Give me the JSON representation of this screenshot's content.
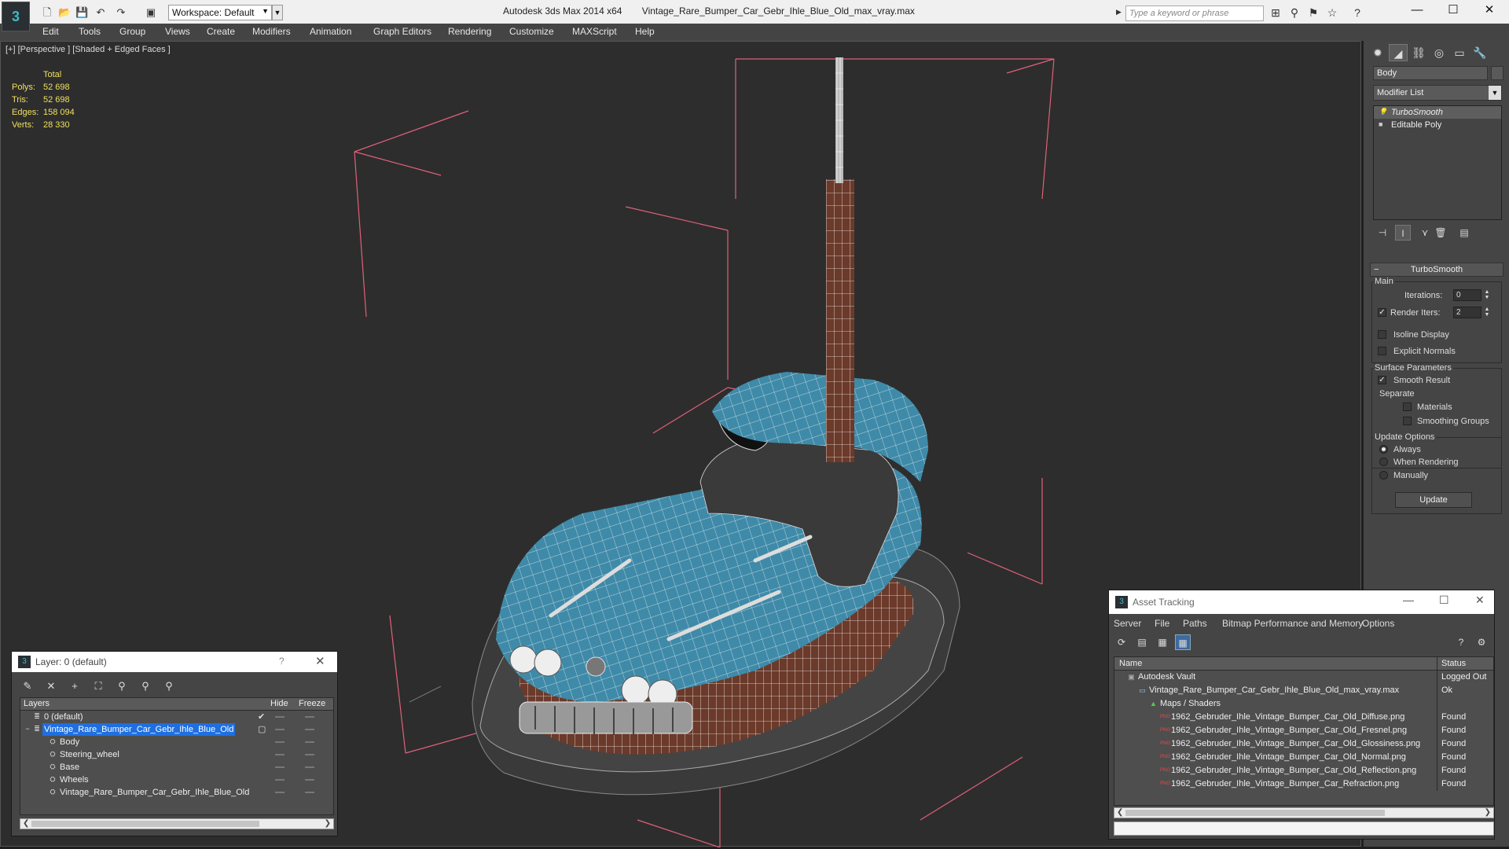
{
  "titlebar": {
    "workspace": "Workspace: Default",
    "app_version": "Autodesk 3ds Max  2014 x64",
    "file_name": "Vintage_Rare_Bumper_Car_Gebr_Ihle_Blue_Old_max_vray.max",
    "search_placeholder": "Type a keyword or phrase"
  },
  "menu": [
    "Edit",
    "Tools",
    "Group",
    "Views",
    "Create",
    "Modifiers",
    "Animation",
    "Graph Editors",
    "Rendering",
    "Customize",
    "MAXScript",
    "Help"
  ],
  "viewport": {
    "label": "[+] [Perspective ] [Shaded + Edged Faces ]",
    "stats_header": "Total",
    "stats": [
      {
        "label": "Polys:",
        "value": "52 698"
      },
      {
        "label": "Tris:",
        "value": "52 698"
      },
      {
        "label": "Edges:",
        "value": "158 094"
      },
      {
        "label": "Verts:",
        "value": "28 330"
      }
    ]
  },
  "command_panel": {
    "object_name": "Body",
    "modifier_list": "Modifier List",
    "stack": [
      "TurboSmooth",
      "Editable Poly"
    ],
    "rollout_title": "TurboSmooth",
    "main_label": "Main",
    "iterations_label": "Iterations:",
    "iterations_value": "0",
    "render_iters_label": "Render Iters:",
    "render_iters_value": "2",
    "isoline_label": "Isoline Display",
    "explicit_normals_label": "Explicit Normals",
    "surface_params_label": "Surface Parameters",
    "smooth_result_label": "Smooth Result",
    "separate_label": "Separate",
    "materials_label": "Materials",
    "smoothing_groups_label": "Smoothing Groups",
    "update_options_label": "Update Options",
    "always_label": "Always",
    "when_rendering_label": "When Rendering",
    "manually_label": "Manually",
    "update_button": "Update"
  },
  "layer_explorer": {
    "title": "Layer: 0 (default)",
    "help": "?",
    "col_layers": "Layers",
    "col_hide": "Hide",
    "col_freeze": "Freeze",
    "rows": [
      {
        "name": "0 (default)",
        "indent": 0,
        "icon": "layer-icon"
      },
      {
        "name": "Vintage_Rare_Bumper_Car_Gebr_Ihle_Blue_Old",
        "indent": 0,
        "icon": "layer-icon",
        "selected": true
      },
      {
        "name": "Body",
        "indent": 1,
        "icon": "object-icon"
      },
      {
        "name": "Steering_wheel",
        "indent": 1,
        "icon": "object-icon"
      },
      {
        "name": "Base",
        "indent": 1,
        "icon": "object-icon"
      },
      {
        "name": "Wheels",
        "indent": 1,
        "icon": "object-icon"
      },
      {
        "name": "Vintage_Rare_Bumper_Car_Gebr_Ihle_Blue_Old",
        "indent": 1,
        "icon": "object-icon"
      }
    ]
  },
  "asset_tracking": {
    "title": "Asset Tracking",
    "menu": [
      "Server",
      "File",
      "Paths",
      "Bitmap Performance and Memory",
      "Options"
    ],
    "col_name": "Name",
    "col_status": "Status",
    "rows": [
      {
        "name": "Autodesk Vault",
        "status": "Logged Out",
        "indent": 0,
        "icon": "vault-icon"
      },
      {
        "name": "Vintage_Rare_Bumper_Car_Gebr_Ihle_Blue_Old_max_vray.max",
        "status": "Ok",
        "indent": 1,
        "icon": "max-file-icon"
      },
      {
        "name": "Maps / Shaders",
        "status": "",
        "indent": 2,
        "icon": "maps-icon"
      },
      {
        "name": "1962_Gebruder_Ihle_Vintage_Bumper_Car_Old_Diffuse.png",
        "status": "Found",
        "indent": 3,
        "icon": "png-icon"
      },
      {
        "name": "1962_Gebruder_Ihle_Vintage_Bumper_Car_Old_Fresnel.png",
        "status": "Found",
        "indent": 3,
        "icon": "png-icon"
      },
      {
        "name": "1962_Gebruder_Ihle_Vintage_Bumper_Car_Old_Glossiness.png",
        "status": "Found",
        "indent": 3,
        "icon": "png-icon"
      },
      {
        "name": "1962_Gebruder_Ihle_Vintage_Bumper_Car_Old_Normal.png",
        "status": "Found",
        "indent": 3,
        "icon": "png-icon"
      },
      {
        "name": "1962_Gebruder_Ihle_Vintage_Bumper_Car_Old_Reflection.png",
        "status": "Found",
        "indent": 3,
        "icon": "png-icon"
      },
      {
        "name": "1962_Gebruder_Ihle_Vintage_Bumper_Car_Refraction.png",
        "status": "Found",
        "indent": 3,
        "icon": "png-icon"
      }
    ]
  },
  "colors": {
    "viewport_bg": "#2d2d2d",
    "stats_text": "#f0e060",
    "bbox_lines": "#e0607a",
    "car_blue": "#3f8aa8",
    "car_brown": "#6b3a2a",
    "selection": "#1f6fe0"
  }
}
